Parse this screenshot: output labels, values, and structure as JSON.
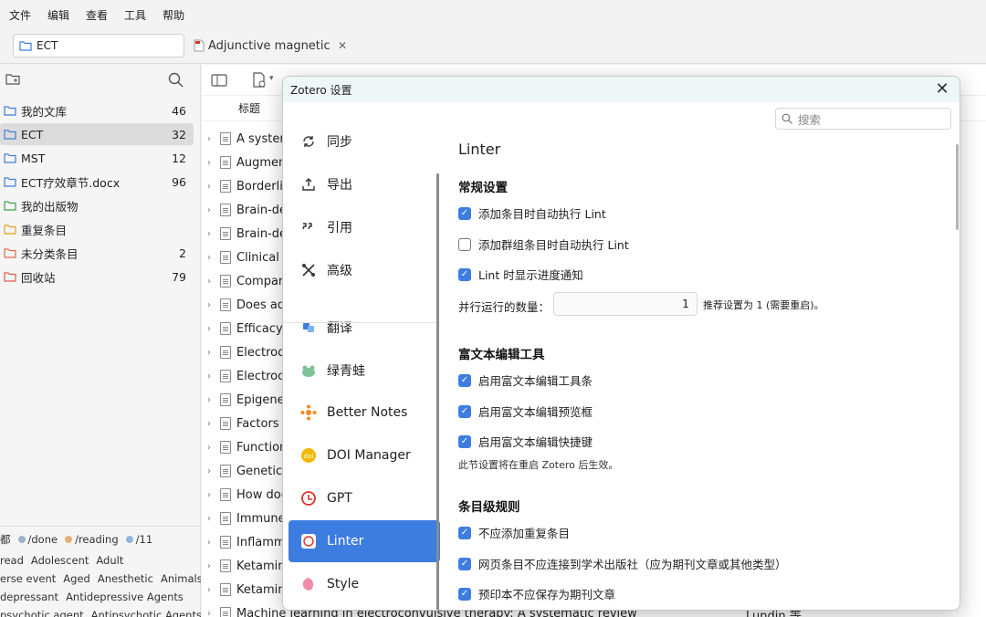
{
  "menu": [
    "文件",
    "编辑",
    "查看",
    "工具",
    "帮助"
  ],
  "collection_search": {
    "value": "ECT"
  },
  "tab": {
    "title": "Adjunctive magnetic seizure therapy",
    "close": "✕"
  },
  "library": {
    "items": [
      {
        "label": "我的文库",
        "count": "46",
        "color": "#3e7de0"
      },
      {
        "label": "ECT",
        "count": "32",
        "color": "#3e7de0",
        "selected": true
      },
      {
        "label": "MST",
        "count": "12",
        "color": "#3e7de0"
      },
      {
        "label": "ECT疗效章节.docx",
        "count": "96",
        "color": "#3e7de0"
      },
      {
        "label": "我的出版物",
        "count": "",
        "color": "#3aa34a"
      },
      {
        "label": "重复条目",
        "count": "",
        "color": "#e0a21e"
      },
      {
        "label": "未分类条目",
        "count": "2",
        "color": "#e06a4a"
      },
      {
        "label": "回收站",
        "count": "79",
        "color": "#e05a4a"
      }
    ]
  },
  "tags": {
    "row1": [
      {
        "label": "都",
        "color": ""
      },
      {
        "label": "/done",
        "color": "#9ab3c7"
      },
      {
        "label": "/reading",
        "color": "#e0b27a"
      },
      {
        "label": "/11",
        "color": "#8fb8e0"
      }
    ],
    "row2": [
      "read",
      "Adolescent",
      "Adult"
    ],
    "row3": [
      "erse event",
      "Aged",
      "Anesthetic",
      "Animals"
    ],
    "row4": [
      "depressant",
      "Antidepressive Agents"
    ],
    "row5": [
      "psychotic agent",
      "Antipsychotic Agents"
    ]
  },
  "items_header": {
    "title": "标题"
  },
  "items": [
    "A system",
    "Augmen",
    "Borderlin",
    "Brain-de",
    "Brain-de",
    "Clinical a",
    "Compara",
    "Does adj",
    "Efficacy a",
    "Electroco",
    "Electroco",
    "Epigenet",
    "Factors f",
    "Function",
    "Genetics",
    "How doe",
    "Immune",
    "Inflamm",
    "Ketamin",
    "Ketamin",
    "Machine learning in electroconvulsive therapy: A systematic review"
  ],
  "last_item_creator": "Lundin 等",
  "dialog": {
    "title": "Zotero 设置",
    "close": "✕",
    "search_placeholder": "搜索",
    "nav": [
      {
        "label": "同步",
        "icon": "sync-icon"
      },
      {
        "label": "导出",
        "icon": "export-icon"
      },
      {
        "label": "引用",
        "icon": "cite-icon"
      },
      {
        "label": "高级",
        "icon": "advanced-icon"
      },
      {
        "label": "翻译",
        "icon": "translate-icon"
      },
      {
        "label": "绿青蛙",
        "icon": "frog-icon"
      },
      {
        "label": "Better Notes",
        "icon": "better-notes-icon"
      },
      {
        "label": "DOI Manager",
        "icon": "doi-icon"
      },
      {
        "label": "GPT",
        "icon": "gpt-icon"
      },
      {
        "label": "Linter",
        "icon": "linter-icon",
        "selected": true
      },
      {
        "label": "Style",
        "icon": "style-icon"
      }
    ],
    "content": {
      "title": "Linter",
      "general": {
        "heading": "常规设置",
        "opt1": "添加条目时自动执行 Lint",
        "opt2": "添加群组条目时自动执行 Lint",
        "opt3": "Lint 时显示进度通知",
        "parallel_label": "并行运行的数量：",
        "parallel_value": "1",
        "parallel_hint": "推荐设置为 1 (需要重启)。"
      },
      "rich": {
        "heading": "富文本编辑工具",
        "opt1": "启用富文本编辑工具条",
        "opt2": "启用富文本编辑预览框",
        "opt3": "启用富文本编辑快捷键",
        "note": "此节设置将在重启 Zotero 后生效。"
      },
      "rules": {
        "heading": "条目级规则",
        "opt1": "不应添加重复条目",
        "opt2": "网页条目不应连接到学术出版社（应为期刊文章或其他类型）",
        "opt3": "预印本不应保存为期刊文章"
      },
      "checks": {
        "g1": true,
        "g2": false,
        "g3": true,
        "r1": true,
        "r2": true,
        "r3": true,
        "i1": true,
        "i2": true,
        "i3": true
      }
    }
  },
  "colors": {
    "accent": "#3e7de0"
  }
}
